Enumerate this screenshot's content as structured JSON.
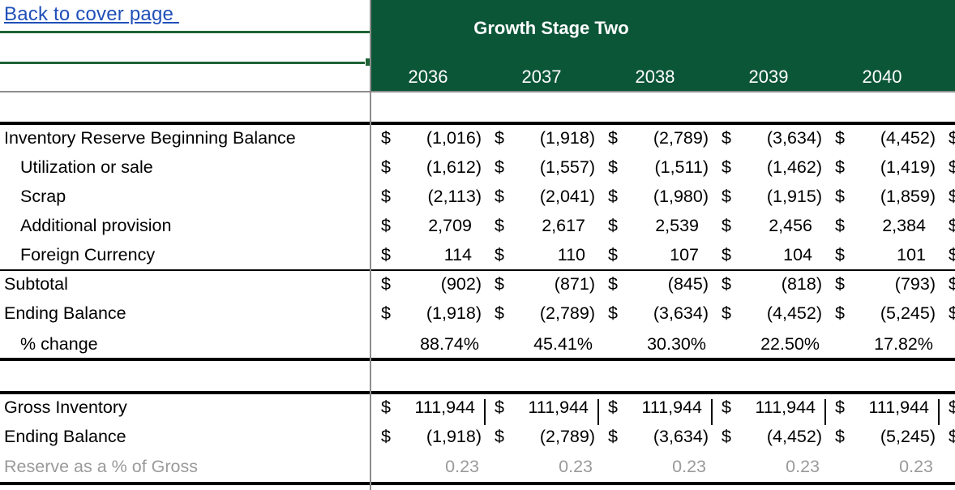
{
  "link": {
    "label": "Back to cover page "
  },
  "header": {
    "stage_title": "Growth Stage Two",
    "years": [
      "2036",
      "2037",
      "2038",
      "2039",
      "2040"
    ]
  },
  "rows": {
    "beginning": {
      "label": "Inventory Reserve Beginning Balance",
      "values": [
        "(1,016)",
        "(1,918)",
        "(2,789)",
        "(3,634)",
        "(4,452)"
      ]
    },
    "utilization": {
      "label": "Utilization or sale",
      "values": [
        "(1,612)",
        "(1,557)",
        "(1,511)",
        "(1,462)",
        "(1,419)"
      ]
    },
    "scrap": {
      "label": "Scrap",
      "values": [
        "(2,113)",
        "(2,041)",
        "(1,980)",
        "(1,915)",
        "(1,859)"
      ]
    },
    "provision": {
      "label": "Additional provision",
      "values": [
        "2,709",
        "2,617",
        "2,539",
        "2,456",
        "2,384"
      ]
    },
    "fx": {
      "label": "Foreign Currency",
      "values": [
        "114",
        "110",
        "107",
        "104",
        "101"
      ]
    },
    "subtotal": {
      "label": "Subtotal",
      "values": [
        "(902)",
        "(871)",
        "(845)",
        "(818)",
        "(793)"
      ]
    },
    "ending": {
      "label": "Ending Balance",
      "values": [
        "(1,918)",
        "(2,789)",
        "(3,634)",
        "(4,452)",
        "(5,245)"
      ]
    },
    "pct_change": {
      "label": "% change",
      "values": [
        "88.74%",
        "45.41%",
        "30.30%",
        "22.50%",
        "17.82%"
      ]
    },
    "gross": {
      "label": "Gross Inventory",
      "values": [
        "111,944",
        "111,944",
        "111,944",
        "111,944",
        "111,944"
      ]
    },
    "ending2": {
      "label": "Ending Balance",
      "values": [
        "(1,918)",
        "(2,789)",
        "(3,634)",
        "(4,452)",
        "(5,245)"
      ]
    },
    "reserve_pct": {
      "label": "Reserve as a % of Gross",
      "values": [
        "0.23",
        "0.23",
        "0.23",
        "0.23",
        "0.23"
      ]
    }
  },
  "currency_symbol": "$",
  "colors": {
    "header_green": "#0c5638",
    "link_blue": "#1f4fb8",
    "muted_gray": "#9a9a9a"
  }
}
